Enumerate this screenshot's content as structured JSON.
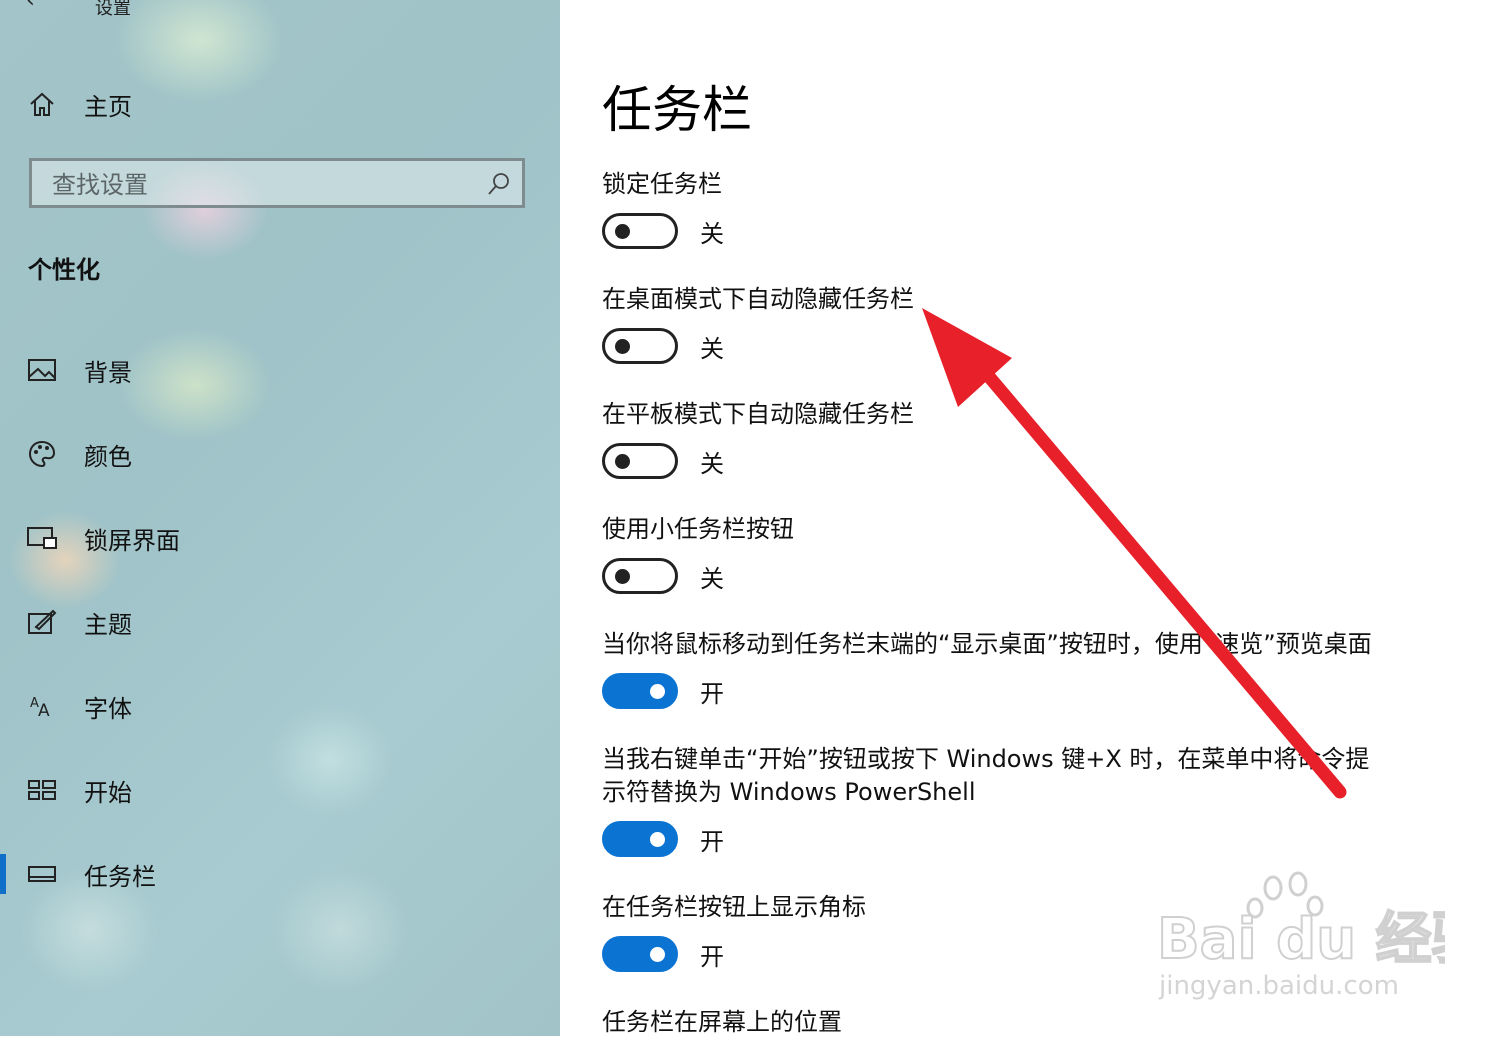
{
  "window": {
    "title": "设置",
    "back_icon": "back-arrow-icon"
  },
  "sidebar": {
    "home_label": "主页",
    "search_placeholder": "查找设置",
    "section_title": "个性化",
    "items": [
      {
        "label": "背景",
        "icon": "picture-icon"
      },
      {
        "label": "颜色",
        "icon": "palette-icon"
      },
      {
        "label": "锁屏界面",
        "icon": "lock-screen-icon"
      },
      {
        "label": "主题",
        "icon": "theme-icon"
      },
      {
        "label": "字体",
        "icon": "font-icon"
      },
      {
        "label": "开始",
        "icon": "start-icon"
      },
      {
        "label": "任务栏",
        "icon": "taskbar-icon",
        "selected": true
      }
    ],
    "accent_color": "#0f6fc9"
  },
  "main": {
    "title": "任务栏",
    "settings": [
      {
        "label": "锁定任务栏",
        "state": "关",
        "on": false
      },
      {
        "label": "在桌面模式下自动隐藏任务栏",
        "state": "关",
        "on": false
      },
      {
        "label": "在平板模式下自动隐藏任务栏",
        "state": "关",
        "on": false
      },
      {
        "label": "使用小任务栏按钮",
        "state": "关",
        "on": false
      },
      {
        "label": "当你将鼠标移动到任务栏末端的“显示桌面”按钮时，使用“速览”预览桌面",
        "state": "开",
        "on": true
      },
      {
        "label": "当我右键单击“开始”按钮或按下 Windows 键+X 时，在菜单中将命令提示符替换为 Windows PowerShell",
        "state": "开",
        "on": true
      },
      {
        "label": "在任务栏按钮上显示角标",
        "state": "开",
        "on": true
      }
    ],
    "next_heading": "任务栏在屏幕上的位置",
    "toggle_on_color": "#0b74d3"
  },
  "watermark": {
    "brand": "Bai du 经验",
    "url": "jingyan.baidu.com"
  },
  "annotation": {
    "arrow_color": "#e8202a"
  }
}
